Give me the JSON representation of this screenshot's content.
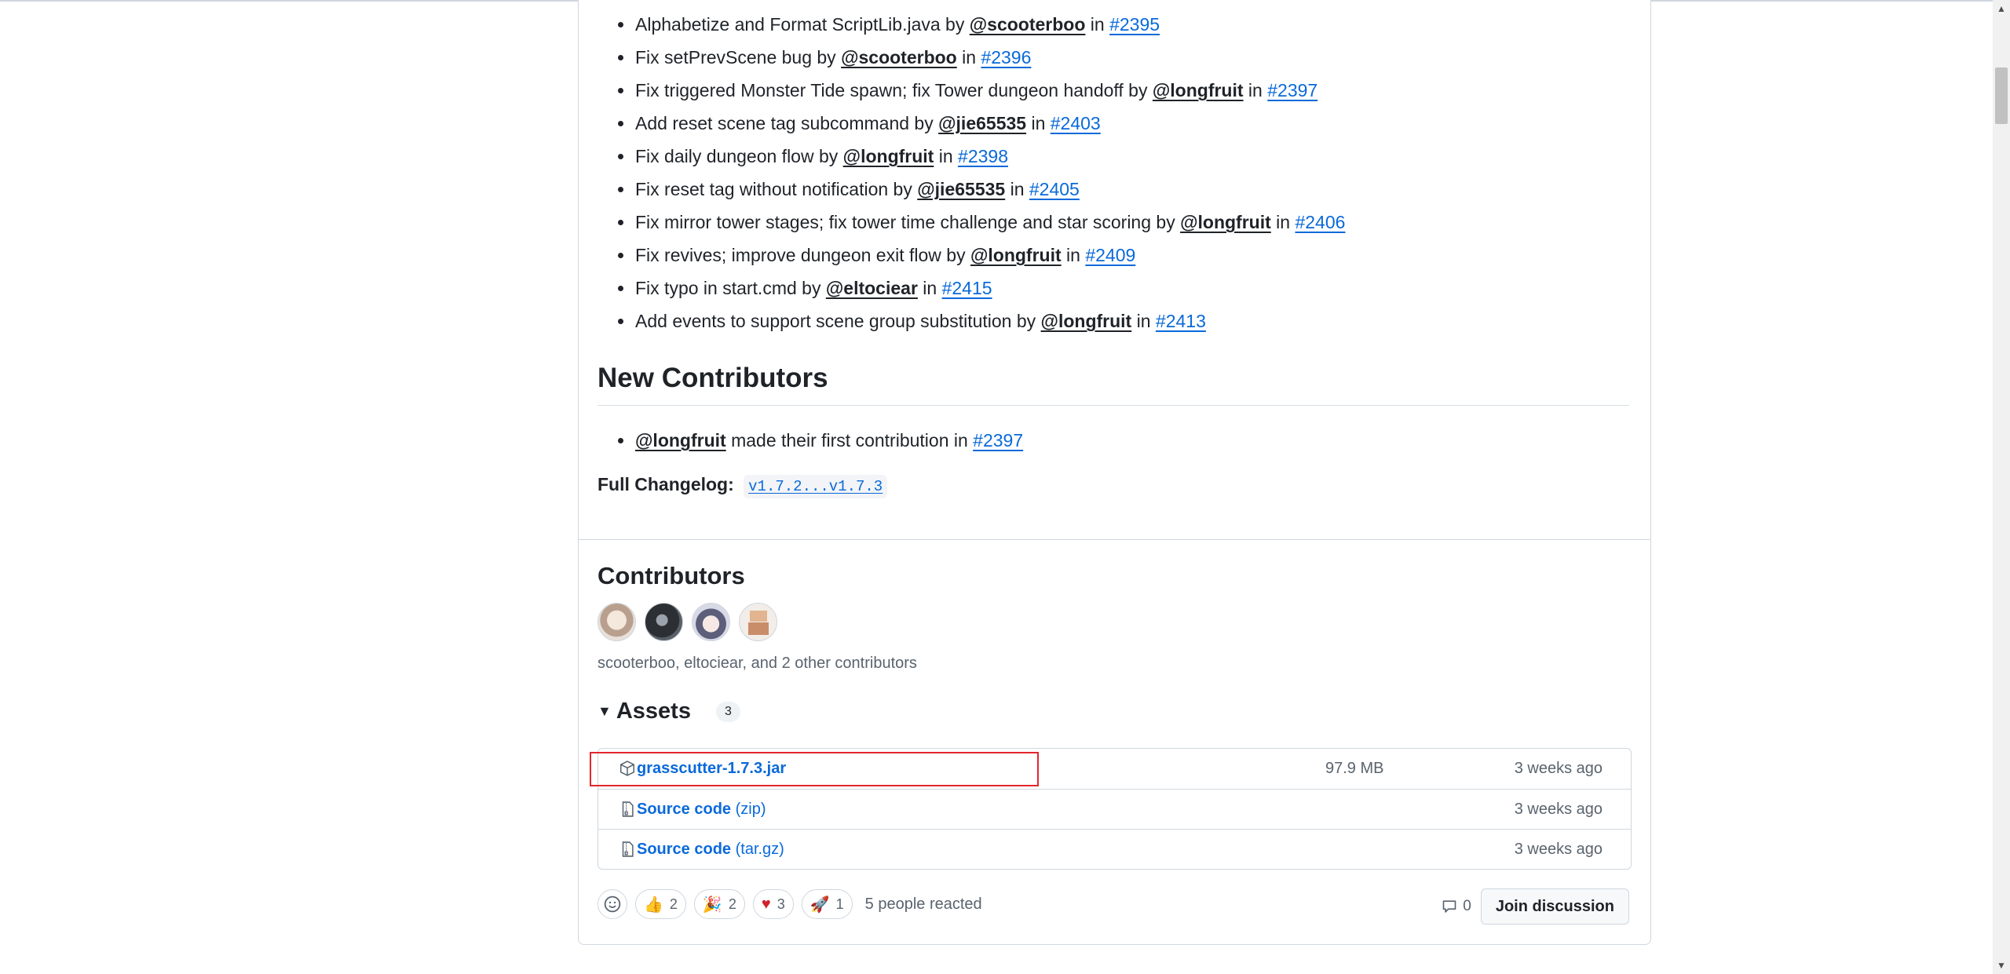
{
  "changes": [
    {
      "text": "Alphabetize and Format ScriptLib.java by ",
      "user": "@scooterboo",
      "in": " in ",
      "pr": "#2395"
    },
    {
      "text": "Fix setPrevScene bug by ",
      "user": "@scooterboo",
      "in": " in ",
      "pr": "#2396"
    },
    {
      "text": "Fix triggered Monster Tide spawn; fix Tower dungeon handoff by ",
      "user": "@longfruit",
      "in": " in ",
      "pr": "#2397"
    },
    {
      "text": "Add reset scene tag subcommand by ",
      "user": "@jie65535",
      "in": " in ",
      "pr": "#2403"
    },
    {
      "text": "Fix daily dungeon flow by ",
      "user": "@longfruit",
      "in": " in ",
      "pr": "#2398"
    },
    {
      "text": "Fix reset tag without notification by ",
      "user": "@jie65535",
      "in": " in ",
      "pr": "#2405"
    },
    {
      "text": "Fix mirror tower stages; fix tower time challenge and star scoring by ",
      "user": "@longfruit",
      "in": " in ",
      "pr": "#2406"
    },
    {
      "text": "Fix revives; improve dungeon exit flow by ",
      "user": "@longfruit",
      "in": " in ",
      "pr": "#2409"
    },
    {
      "text": "Fix typo in start.cmd by ",
      "user": "@eltociear",
      "in": " in ",
      "pr": "#2415"
    },
    {
      "text": "Add events to support scene group substitution by ",
      "user": "@longfruit",
      "in": " in ",
      "pr": "#2413"
    }
  ],
  "new_contributors": {
    "title": "New Contributors",
    "item": {
      "user": "@longfruit",
      "text": " made their first contribution in ",
      "pr": "#2397"
    }
  },
  "changelog": {
    "label": "Full Changelog:",
    "range": "v1.7.2...v1.7.3"
  },
  "contributors": {
    "title": "Contributors",
    "names": "scooterboo, eltociear, and 2 other contributors"
  },
  "assets": {
    "title": "Assets",
    "count": "3",
    "items": [
      {
        "name": "grasscutter-1.7.3.jar",
        "sub": "",
        "size": "97.9 MB",
        "date": "3 weeks ago",
        "icon": "package-icon"
      },
      {
        "name": "Source code",
        "sub": " (zip)",
        "size": "",
        "date": "3 weeks ago",
        "icon": "file-zip-icon"
      },
      {
        "name": "Source code",
        "sub": " (tar.gz)",
        "size": "",
        "date": "3 weeks ago",
        "icon": "file-zip-icon"
      }
    ]
  },
  "reactions": {
    "items": [
      {
        "emoji": "👍",
        "count": "2",
        "name": "thumbs-up"
      },
      {
        "emoji": "🎉",
        "count": "2",
        "name": "hooray"
      },
      {
        "emoji": "♥",
        "count": "3",
        "name": "heart"
      },
      {
        "emoji": "🚀",
        "count": "1",
        "name": "rocket"
      }
    ],
    "summary": "5 people reacted"
  },
  "discussion": {
    "comments": "0",
    "button": "Join discussion"
  },
  "colors": {
    "link": "#0969da",
    "highlight": "#e3262c",
    "heart": "#cf222e"
  }
}
